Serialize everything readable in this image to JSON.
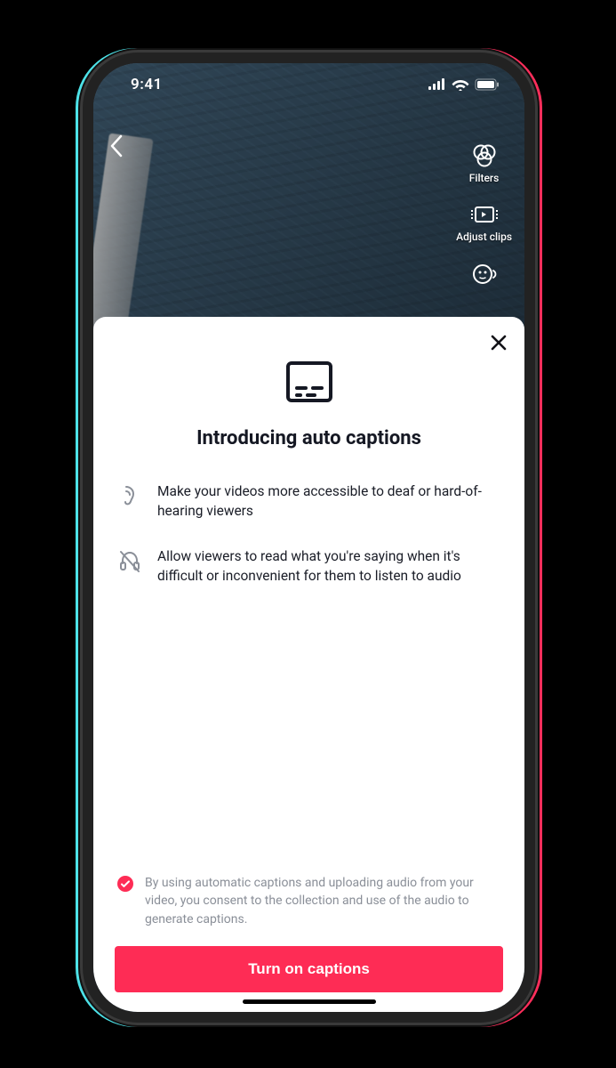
{
  "status": {
    "time": "9:41"
  },
  "editor": {
    "tools": {
      "filters_label": "Filters",
      "adjust_label": "Adjust clips"
    }
  },
  "modal": {
    "title": "Introducing auto captions",
    "feature1": "Make your videos more accessible to deaf or hard-of-hearing viewers",
    "feature2": "Allow viewers to read what you're saying when it's difficult or inconvenient for them to listen to audio",
    "consent_text": "By using automatic captions and uploading audio from your video, you consent to the collection and use of the audio to generate captions.",
    "cta_label": "Turn on captions"
  }
}
